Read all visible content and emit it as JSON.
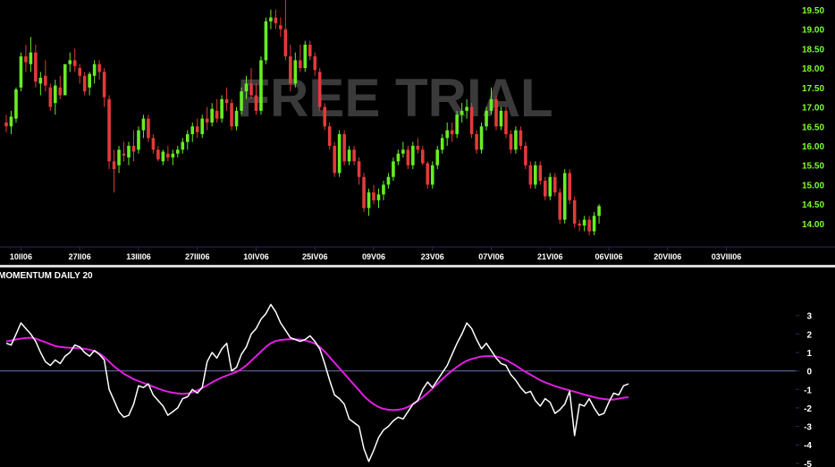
{
  "watermark": "FREE TRIAL",
  "colors": {
    "up": "#66ee22",
    "down": "#e23a3a",
    "momentum": "#ffffff",
    "signal": "#e01ee0",
    "zero_line": "#7070b0",
    "divider": "#d8d8d8",
    "axis": "#2a2a66"
  },
  "chart_data": [
    {
      "type": "candlestick",
      "title": "",
      "y_ticks": [
        14.0,
        14.5,
        15.0,
        15.5,
        16.0,
        16.5,
        17.0,
        17.5,
        18.0,
        18.5,
        19.0,
        19.5
      ],
      "y_tick_labels": [
        "14.00",
        "14.50",
        "15.00",
        "15.50",
        "16.00",
        "16.50",
        "17.00",
        "17.50",
        "18.00",
        "18.50",
        "19.00",
        "19.50"
      ],
      "ylim": [
        13.4,
        19.75
      ],
      "x_tick_labels": [
        "10II06",
        "27II06",
        "13III06",
        "27III06",
        "10IV06",
        "25IV06",
        "09V06",
        "23V06",
        "07VI06",
        "21VI06",
        "06VII06",
        "20VII06",
        "03VIII06"
      ],
      "x_tick_index": [
        3,
        15,
        27,
        39,
        51,
        63,
        75,
        87,
        99,
        111,
        123,
        135,
        147
      ],
      "ohlc": [
        [
          16.6,
          16.8,
          16.35,
          16.5
        ],
        [
          16.5,
          16.9,
          16.3,
          16.75
        ],
        [
          16.7,
          17.5,
          16.6,
          17.45
        ],
        [
          17.5,
          18.4,
          17.4,
          18.3
        ],
        [
          18.3,
          18.6,
          17.9,
          18.15
        ],
        [
          18.1,
          18.8,
          17.9,
          18.4
        ],
        [
          18.4,
          18.6,
          17.5,
          17.65
        ],
        [
          17.6,
          17.9,
          17.3,
          17.75
        ],
        [
          17.8,
          18.2,
          17.4,
          17.55
        ],
        [
          17.5,
          17.6,
          16.9,
          17.0
        ],
        [
          17.1,
          17.7,
          16.8,
          17.55
        ],
        [
          17.5,
          17.8,
          17.2,
          17.3
        ],
        [
          17.3,
          18.1,
          17.3,
          18.1
        ],
        [
          18.1,
          18.4,
          17.9,
          18.2
        ],
        [
          18.2,
          18.5,
          17.9,
          18.05
        ],
        [
          18.0,
          18.1,
          17.6,
          17.8
        ],
        [
          17.8,
          17.9,
          17.3,
          17.4
        ],
        [
          17.5,
          17.9,
          17.3,
          17.85
        ],
        [
          17.8,
          18.2,
          17.6,
          18.1
        ],
        [
          18.1,
          18.2,
          17.7,
          17.9
        ],
        [
          17.9,
          18.0,
          17.0,
          17.25
        ],
        [
          17.2,
          17.3,
          15.4,
          15.6
        ],
        [
          15.6,
          15.9,
          14.8,
          15.4
        ],
        [
          15.5,
          16.0,
          15.3,
          15.9
        ],
        [
          15.8,
          16.1,
          15.6,
          15.75
        ],
        [
          15.7,
          16.1,
          15.5,
          16.0
        ],
        [
          16.0,
          16.4,
          15.6,
          15.85
        ],
        [
          15.9,
          16.5,
          15.8,
          16.4
        ],
        [
          16.4,
          16.8,
          16.2,
          16.7
        ],
        [
          16.7,
          16.8,
          16.1,
          16.2
        ],
        [
          16.2,
          16.3,
          15.8,
          15.9
        ],
        [
          15.9,
          16.0,
          15.6,
          15.65
        ],
        [
          15.6,
          15.9,
          15.5,
          15.85
        ],
        [
          15.8,
          16.0,
          15.6,
          15.7
        ],
        [
          15.7,
          15.9,
          15.5,
          15.8
        ],
        [
          15.8,
          16.0,
          15.7,
          15.9
        ],
        [
          15.9,
          16.2,
          15.8,
          16.1
        ],
        [
          16.1,
          16.4,
          15.9,
          16.3
        ],
        [
          16.3,
          16.6,
          16.1,
          16.5
        ],
        [
          16.5,
          16.7,
          16.2,
          16.35
        ],
        [
          16.3,
          16.8,
          16.2,
          16.7
        ],
        [
          16.7,
          17.0,
          16.4,
          16.6
        ],
        [
          16.6,
          17.1,
          16.5,
          16.95
        ],
        [
          16.9,
          17.2,
          16.6,
          16.7
        ],
        [
          16.7,
          17.3,
          16.6,
          17.2
        ],
        [
          17.2,
          17.5,
          16.9,
          17.1
        ],
        [
          17.1,
          17.2,
          16.4,
          16.5
        ],
        [
          16.5,
          17.0,
          16.4,
          16.9
        ],
        [
          16.9,
          17.5,
          16.8,
          17.4
        ],
        [
          17.4,
          17.8,
          17.2,
          17.6
        ],
        [
          17.6,
          18.0,
          17.2,
          17.3
        ],
        [
          17.3,
          17.6,
          16.8,
          16.9
        ],
        [
          16.9,
          18.3,
          16.8,
          18.2
        ],
        [
          18.2,
          19.3,
          18.1,
          19.2
        ],
        [
          19.2,
          19.5,
          19.0,
          19.3
        ],
        [
          19.3,
          19.5,
          19.0,
          19.15
        ],
        [
          19.1,
          19.3,
          18.8,
          19.0
        ],
        [
          19.0,
          19.8,
          18.2,
          18.3
        ],
        [
          18.3,
          18.6,
          17.4,
          17.6
        ],
        [
          17.6,
          18.4,
          17.5,
          18.2
        ],
        [
          18.2,
          18.6,
          17.9,
          18.0
        ],
        [
          18.0,
          18.7,
          17.9,
          18.6
        ],
        [
          18.6,
          18.7,
          18.2,
          18.3
        ],
        [
          18.3,
          18.4,
          17.8,
          17.95
        ],
        [
          17.9,
          18.0,
          16.9,
          17.0
        ],
        [
          17.0,
          17.1,
          16.4,
          16.5
        ],
        [
          16.5,
          16.6,
          15.9,
          16.0
        ],
        [
          16.0,
          16.1,
          15.2,
          15.3
        ],
        [
          15.3,
          16.4,
          15.2,
          16.3
        ],
        [
          16.3,
          16.4,
          15.5,
          15.6
        ],
        [
          15.6,
          16.0,
          15.5,
          15.9
        ],
        [
          15.9,
          16.0,
          15.5,
          15.6
        ],
        [
          15.6,
          15.7,
          15.0,
          15.2
        ],
        [
          15.2,
          15.3,
          14.3,
          14.4
        ],
        [
          14.4,
          14.9,
          14.2,
          14.8
        ],
        [
          14.8,
          15.0,
          14.5,
          14.6
        ],
        [
          14.6,
          14.9,
          14.4,
          14.75
        ],
        [
          14.75,
          15.1,
          14.6,
          15.0
        ],
        [
          15.0,
          15.3,
          14.9,
          15.2
        ],
        [
          15.2,
          15.7,
          15.1,
          15.6
        ],
        [
          15.6,
          15.9,
          15.5,
          15.8
        ],
        [
          15.8,
          16.1,
          15.7,
          15.9
        ],
        [
          15.9,
          16.0,
          15.4,
          15.5
        ],
        [
          15.5,
          16.1,
          15.4,
          16.0
        ],
        [
          16.0,
          16.2,
          15.8,
          15.9
        ],
        [
          15.9,
          16.0,
          15.5,
          15.55
        ],
        [
          15.55,
          15.6,
          14.9,
          15.0
        ],
        [
          15.0,
          15.6,
          14.9,
          15.5
        ],
        [
          15.5,
          16.0,
          15.4,
          15.9
        ],
        [
          15.9,
          16.3,
          15.8,
          16.2
        ],
        [
          16.2,
          16.6,
          16.0,
          16.4
        ],
        [
          16.4,
          16.6,
          16.1,
          16.3
        ],
        [
          16.3,
          16.9,
          16.2,
          16.8
        ],
        [
          16.8,
          17.1,
          16.6,
          16.9
        ],
        [
          16.9,
          17.2,
          16.7,
          17.0
        ],
        [
          17.0,
          17.1,
          16.2,
          16.3
        ],
        [
          16.3,
          16.4,
          15.8,
          15.9
        ],
        [
          15.9,
          16.6,
          15.8,
          16.5
        ],
        [
          16.5,
          17.0,
          16.4,
          16.9
        ],
        [
          16.9,
          17.5,
          16.8,
          17.2
        ],
        [
          17.2,
          17.3,
          16.4,
          16.5
        ],
        [
          16.5,
          17.0,
          16.4,
          16.9
        ],
        [
          16.9,
          17.0,
          16.2,
          16.3
        ],
        [
          16.3,
          16.4,
          15.8,
          15.9
        ],
        [
          15.9,
          16.5,
          15.8,
          16.4
        ],
        [
          16.4,
          16.5,
          15.9,
          16.0
        ],
        [
          16.0,
          16.1,
          15.4,
          15.5
        ],
        [
          15.5,
          15.6,
          14.9,
          15.0
        ],
        [
          15.0,
          15.6,
          14.9,
          15.5
        ],
        [
          15.5,
          15.6,
          15.0,
          15.1
        ],
        [
          15.1,
          15.2,
          14.6,
          14.7
        ],
        [
          14.7,
          15.3,
          14.6,
          15.2
        ],
        [
          15.2,
          15.3,
          14.7,
          14.8
        ],
        [
          14.8,
          14.9,
          14.0,
          14.1
        ],
        [
          14.1,
          15.4,
          14.0,
          15.3
        ],
        [
          15.3,
          15.4,
          14.5,
          14.6
        ],
        [
          14.6,
          14.7,
          13.9,
          14.0
        ],
        [
          14.0,
          14.1,
          13.8,
          13.95
        ],
        [
          13.95,
          14.2,
          13.8,
          14.1
        ],
        [
          14.1,
          14.2,
          13.7,
          13.8
        ],
        [
          13.8,
          14.3,
          13.7,
          14.2
        ],
        [
          14.2,
          14.5,
          14.0,
          14.45
        ]
      ]
    },
    {
      "type": "line",
      "title": "MOMENTUM DAILY 20",
      "y_ticks": [
        -5,
        -4,
        -3,
        -2,
        -1,
        0,
        1,
        2,
        3
      ],
      "y_tick_labels": [
        "-5",
        "-4",
        "-3",
        "-2",
        "-1",
        "0",
        "1",
        "2",
        "3"
      ],
      "ylim": [
        -5.2,
        4.1
      ],
      "series": [
        {
          "values": [
            1.5,
            1.4,
            2.0,
            2.6,
            2.3,
            2.0,
            1.6,
            1.0,
            0.5,
            0.3,
            0.6,
            0.4,
            0.8,
            1.0,
            1.4,
            1.3,
            1.0,
            0.8,
            1.1,
            0.9,
            0.6,
            -1.0,
            -1.6,
            -2.2,
            -2.5,
            -2.4,
            -1.8,
            -0.8,
            -0.9,
            -0.7,
            -1.3,
            -1.6,
            -1.9,
            -2.4,
            -2.2,
            -2.0,
            -1.5,
            -1.4,
            -1.0,
            -1.2,
            -0.9,
            0.5,
            1.0,
            0.7,
            1.2,
            1.5,
            0.0,
            0.2,
            0.9,
            1.3,
            2.0,
            2.3,
            2.8,
            3.1,
            3.6,
            3.2,
            2.6,
            2.2,
            1.8,
            1.7,
            1.6,
            1.7,
            1.9,
            1.6,
            1.2,
            0.4,
            -0.5,
            -1.3,
            -1.5,
            -1.8,
            -2.6,
            -2.8,
            -3.0,
            -4.2,
            -4.9,
            -4.3,
            -3.6,
            -3.2,
            -3.0,
            -2.7,
            -2.5,
            -2.6,
            -2.2,
            -1.8,
            -1.6,
            -1.0,
            -0.6,
            -0.9,
            -0.5,
            -0.1,
            0.3,
            0.9,
            1.5,
            2.0,
            2.6,
            2.3,
            1.7,
            1.2,
            1.5,
            1.1,
            0.7,
            0.4,
            0.3,
            -0.2,
            -0.5,
            -0.9,
            -1.2,
            -1.1,
            -1.6,
            -1.9,
            -1.5,
            -1.7,
            -2.3,
            -2.1,
            -1.8,
            -1.1,
            -3.5,
            -1.8,
            -1.9,
            -1.5,
            -2.0,
            -2.4,
            -2.3,
            -1.7,
            -1.2,
            -1.3,
            -0.8,
            -0.7
          ],
          "color": "#ffffff"
        },
        {
          "values": [
            1.6,
            1.65,
            1.7,
            1.75,
            1.78,
            1.8,
            1.75,
            1.65,
            1.55,
            1.45,
            1.35,
            1.3,
            1.27,
            1.25,
            1.24,
            1.23,
            1.2,
            1.15,
            1.08,
            0.95,
            0.75,
            0.5,
            0.25,
            0.05,
            -0.15,
            -0.3,
            -0.45,
            -0.55,
            -0.65,
            -0.75,
            -0.85,
            -0.95,
            -1.05,
            -1.12,
            -1.18,
            -1.22,
            -1.24,
            -1.22,
            -1.15,
            -1.05,
            -0.92,
            -0.78,
            -0.62,
            -0.48,
            -0.35,
            -0.25,
            -0.15,
            -0.05,
            0.1,
            0.3,
            0.55,
            0.8,
            1.05,
            1.3,
            1.5,
            1.62,
            1.68,
            1.7,
            1.71,
            1.71,
            1.7,
            1.65,
            1.58,
            1.48,
            1.3,
            1.05,
            0.75,
            0.45,
            0.15,
            -0.15,
            -0.45,
            -0.75,
            -1.05,
            -1.35,
            -1.6,
            -1.8,
            -1.95,
            -2.05,
            -2.1,
            -2.12,
            -2.1,
            -2.05,
            -1.95,
            -1.8,
            -1.62,
            -1.42,
            -1.2,
            -0.95,
            -0.7,
            -0.45,
            -0.2,
            0.02,
            0.22,
            0.4,
            0.55,
            0.65,
            0.72,
            0.78,
            0.8,
            0.8,
            0.78,
            0.72,
            0.6,
            0.45,
            0.3,
            0.12,
            -0.05,
            -0.2,
            -0.35,
            -0.5,
            -0.62,
            -0.72,
            -0.82,
            -0.9,
            -0.98,
            -1.05,
            -1.12,
            -1.2,
            -1.28,
            -1.35,
            -1.42,
            -1.48,
            -1.52,
            -1.55,
            -1.55,
            -1.5,
            -1.45,
            -1.42
          ],
          "color": "#e01ee0"
        }
      ],
      "reference_line": 0
    }
  ]
}
